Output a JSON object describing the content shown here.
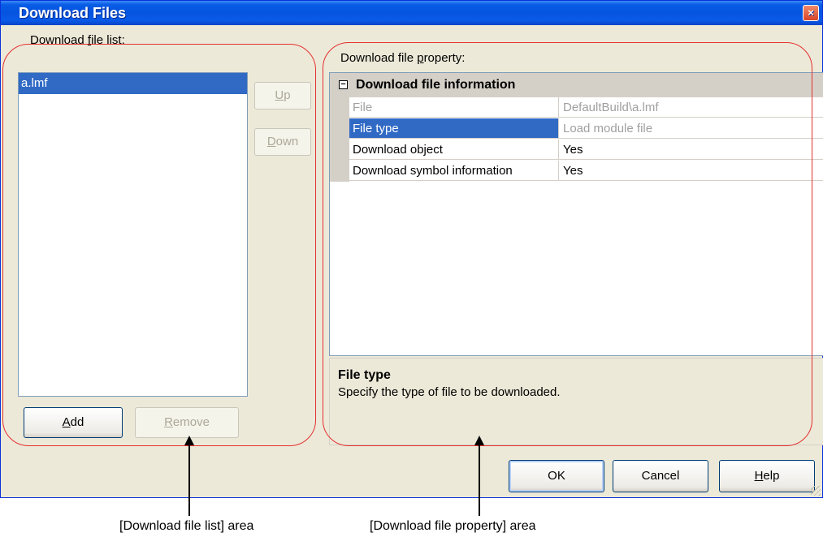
{
  "window": {
    "title": "Download Files",
    "close_glyph": "×"
  },
  "left_panel": {
    "label_pre": "Download ",
    "label_key": "f",
    "label_post": "ile list:",
    "files": [
      "a.lmf"
    ],
    "up_key": "U",
    "up_rest": "p",
    "down_key": "D",
    "down_rest": "own",
    "add_key": "A",
    "add_rest": "dd",
    "remove_key": "R",
    "remove_rest": "emove"
  },
  "right_panel": {
    "label_pre": "Download file ",
    "label_key": "p",
    "label_post": "roperty:",
    "category": {
      "toggle": "−",
      "label": "Download file information"
    },
    "properties": [
      {
        "name": "File",
        "value": "DefaultBuild\\a.lmf"
      },
      {
        "name": "File type",
        "value": "Load module file"
      },
      {
        "name": "Download object",
        "value": "Yes"
      },
      {
        "name": "Download symbol information",
        "value": "Yes"
      }
    ],
    "description": {
      "title": "File type",
      "text": "Specify the type of file to be downloaded."
    }
  },
  "footer": {
    "ok": "OK",
    "cancel": "Cancel",
    "help_key": "H",
    "help_rest": "elp"
  },
  "annotations": {
    "left_caption": "[Download file list] area",
    "right_caption": "[Download file property] area"
  },
  "colors": {
    "selection": "#316ac5",
    "annotation_red": "#e53030",
    "titlebar": "#0454e0"
  }
}
